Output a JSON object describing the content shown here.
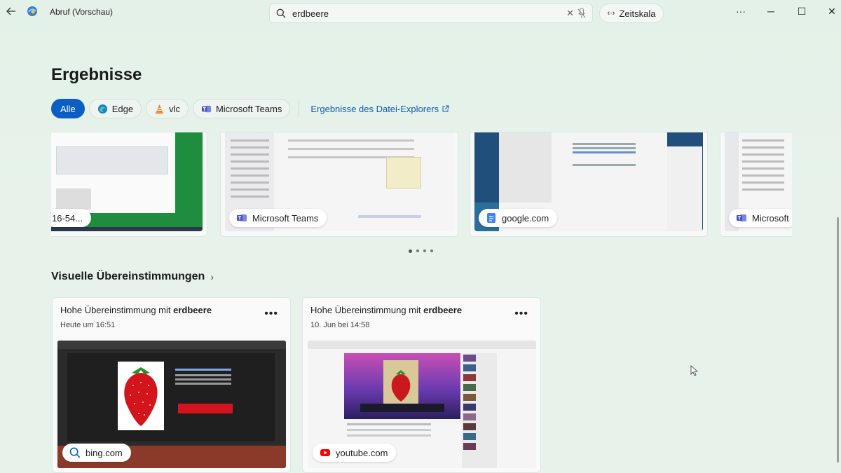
{
  "titlebar": {
    "app_title": "Abruf (Vorschau)",
    "search_value": "erdbeere",
    "timeline_label": "Zeitskala",
    "more_label": "···",
    "minimize": "─",
    "maximize": "☐",
    "close": "✕"
  },
  "page": {
    "title": "Ergebnisse"
  },
  "filters": {
    "items": [
      {
        "label": "Alle",
        "active": true
      },
      {
        "label": "Edge"
      },
      {
        "label": "vlc"
      },
      {
        "label": "Microsoft Teams"
      }
    ],
    "explorer_link": "Ergebnisse des Datei-Explorers"
  },
  "results": [
    {
      "source": "16-54..."
    },
    {
      "source": "Microsoft Teams"
    },
    {
      "source": "google.com"
    },
    {
      "source": "Microsoft"
    }
  ],
  "visual": {
    "section_title": "Visuelle Übereinstimmungen",
    "cards": [
      {
        "title_prefix": "Hohe Übereinstimmung mit ",
        "title_term": "erdbeere",
        "date": "Heute um 16:51",
        "source": "bing.com"
      },
      {
        "title_prefix": "Hohe Übereinstimmung mit ",
        "title_term": "erdbeere",
        "date": "10. Jun bei 14:58",
        "source": "youtube.com"
      }
    ]
  },
  "colors": {
    "accent": "#0a5ec4",
    "link": "#0b5bb8",
    "background": "#e3f1e8"
  }
}
